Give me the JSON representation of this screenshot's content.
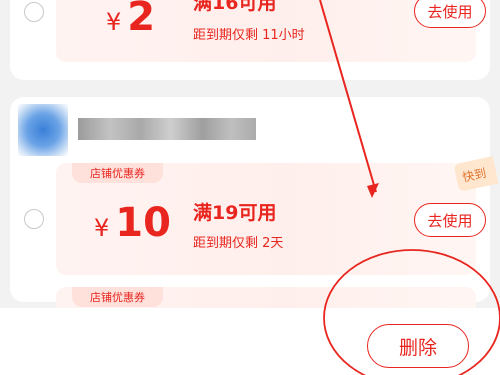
{
  "coupons": [
    {
      "currency": "¥",
      "amount": "2",
      "condition": "满16可用",
      "expiry": "距到期仅剩 11小时",
      "use_label": "去使用"
    },
    {
      "store_tag": "店铺优惠券",
      "currency": "¥",
      "amount": "10",
      "condition": "满19可用",
      "expiry": "距到期仅剩 2天",
      "use_label": "去使用",
      "corner_badge": "快到"
    },
    {
      "store_tag": "店铺优惠券"
    }
  ],
  "footer": {
    "delete_label": "删除"
  },
  "colors": {
    "accent": "#e8251f",
    "coupon_bg": "#fff1ee",
    "page_bg": "#f2f2f2"
  }
}
